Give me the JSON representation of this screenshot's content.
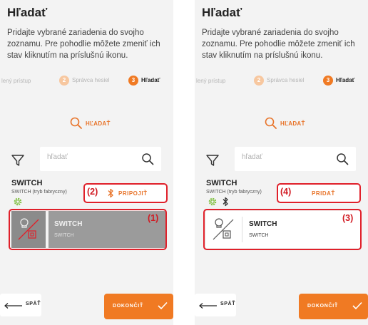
{
  "colors": {
    "accent": "#f07a23",
    "annotation": "#e0202a",
    "background": "#f3f3f3"
  },
  "screens": [
    {
      "title": "Hľadať",
      "description": "Pridajte vybrané zariadenia do svojho zoznamu. Pre pohodlie môžete zmeniť ich stav kliknutím na príslušnú ikonu.",
      "stepper": {
        "step1": "lený prístup",
        "step2_num": "2",
        "step2": "Správca hesiel",
        "step3_num": "3",
        "step3": "Hľadať"
      },
      "search_link": "HĽADAŤ",
      "search": {
        "placeholder": "hľadať"
      },
      "device": {
        "name": "SWITCH",
        "subtitle": "SWITCH (tryb fabryczny)"
      },
      "action_label": "PRIPOJIŤ",
      "card": {
        "name": "SWITCH",
        "sub": "SWITCH"
      },
      "annotations": {
        "action": "(2)",
        "card": "(1)"
      },
      "back": "SPÄŤ",
      "done": "DOKONČIŤ"
    },
    {
      "title": "Hľadať",
      "description": "Pridajte vybrané zariadenia do svojho zoznamu. Pre pohodlie môžete zmeniť ich stav kliknutím na príslušnú ikonu.",
      "stepper": {
        "step1": "lený prístup",
        "step2_num": "2",
        "step2": "Správca hesiel",
        "step3_num": "3",
        "step3": "Hľadať"
      },
      "search_link": "HĽADAŤ",
      "search": {
        "placeholder": "hľadať"
      },
      "device": {
        "name": "SWITCH",
        "subtitle": "SWITCH (tryb fabryczny)"
      },
      "action_label": "PRIDAŤ",
      "card": {
        "name": "SWITCH",
        "sub": "SWITCH"
      },
      "annotations": {
        "action": "(4)",
        "card": "(3)"
      },
      "back": "SPÄŤ",
      "done": "DOKONČIŤ"
    }
  ]
}
